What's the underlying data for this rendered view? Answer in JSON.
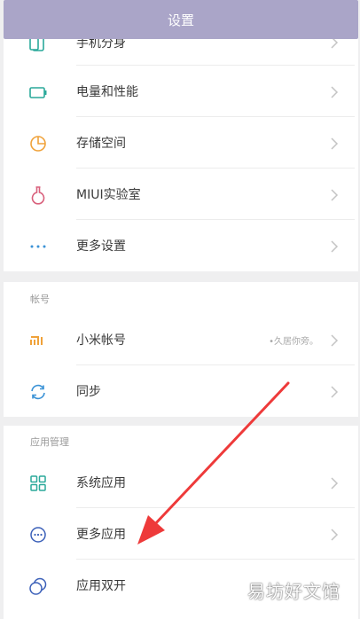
{
  "header": {
    "title": "设置"
  },
  "section_top": {
    "items": [
      {
        "label": "手机分身",
        "icon": "phone-clone-icon"
      },
      {
        "label": "电量和性能",
        "icon": "battery-icon"
      },
      {
        "label": "存储空间",
        "icon": "storage-pie-icon"
      },
      {
        "label": "MIUI实验室",
        "icon": "flask-icon"
      },
      {
        "label": "更多设置",
        "icon": "more-dots-icon"
      }
    ]
  },
  "section_account": {
    "title": "帐号",
    "items": [
      {
        "label": "小米帐号",
        "value": "•久居你旁。",
        "icon": "mi-logo-icon"
      },
      {
        "label": "同步",
        "icon": "sync-icon"
      }
    ]
  },
  "section_apps": {
    "title": "应用管理",
    "items": [
      {
        "label": "系统应用",
        "icon": "grid-apps-icon"
      },
      {
        "label": "更多应用",
        "icon": "more-apps-icon"
      },
      {
        "label": "应用双开",
        "icon": "dual-apps-icon"
      }
    ]
  },
  "watermark": "易坊好文馆",
  "colors": {
    "header_bg": "#aaa5c8",
    "icon_teal": "#2aa99a",
    "icon_orange": "#f0a23a",
    "icon_pink": "#d9607c",
    "icon_blue": "#3a92d6",
    "annotation_red": "#ee3a3a"
  }
}
